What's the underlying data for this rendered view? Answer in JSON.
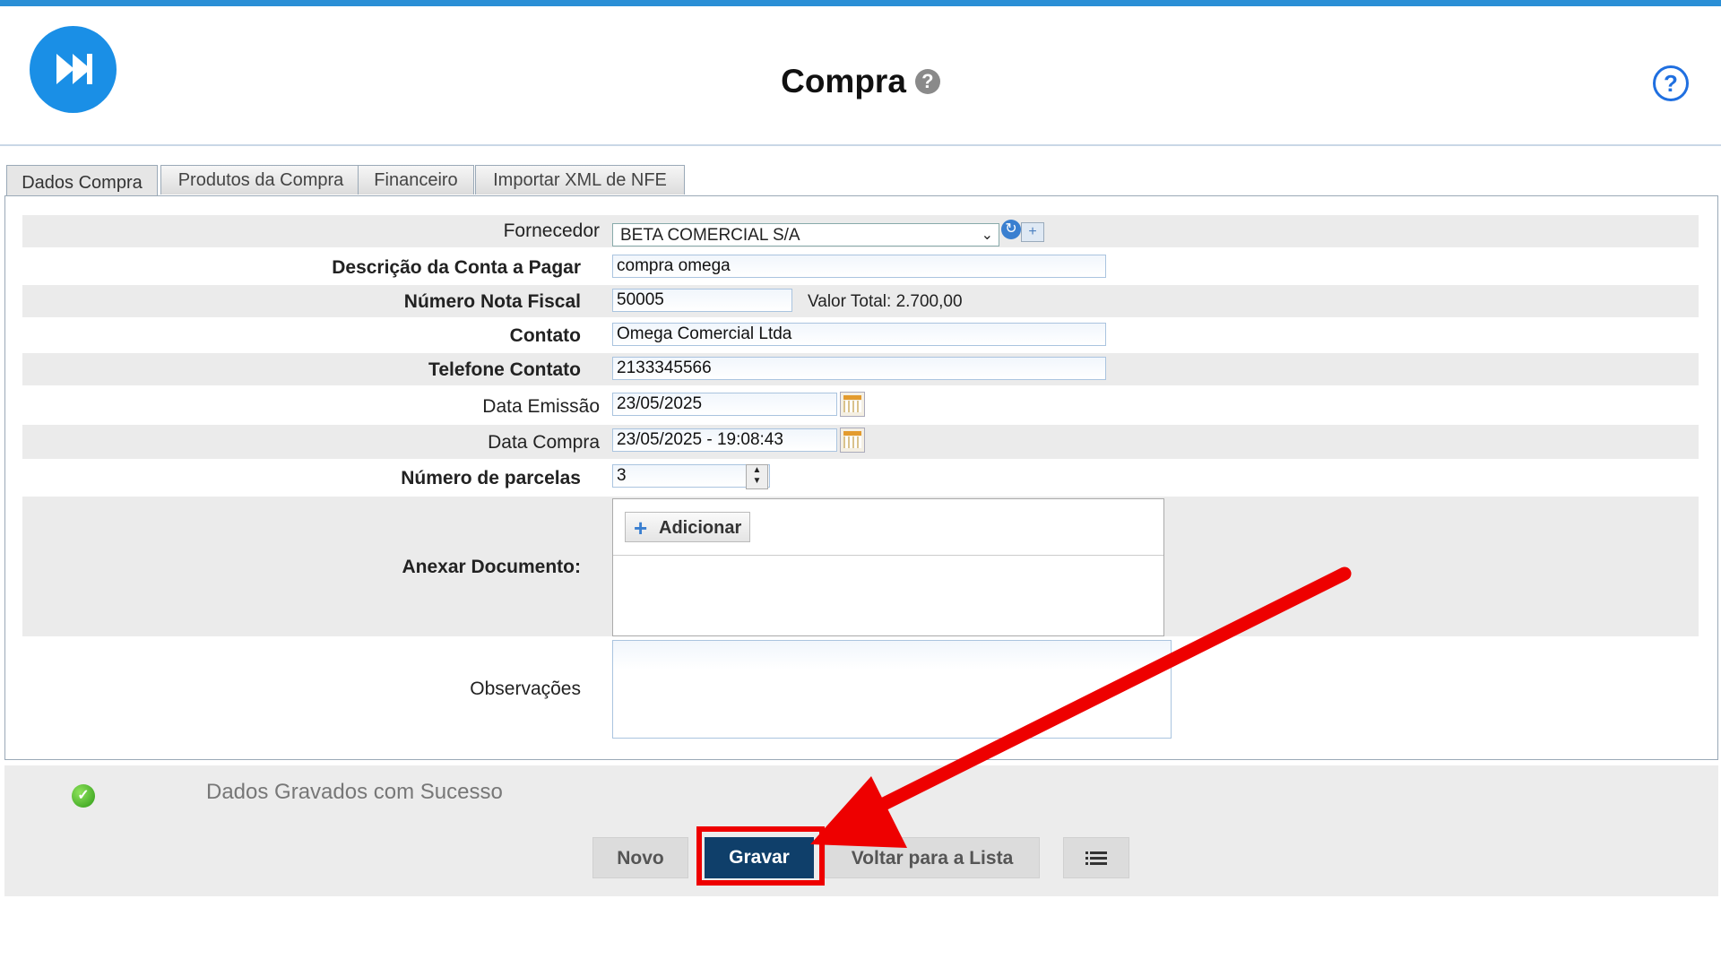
{
  "header": {
    "title": "Compra",
    "title_help_icon": "?",
    "help_icon": "?",
    "logo_icon": "fast-forward-icon"
  },
  "tabs": [
    {
      "label": "Dados Compra",
      "active": true
    },
    {
      "label": "Produtos da Compra",
      "active": false
    },
    {
      "label": "Financeiro",
      "active": false
    },
    {
      "label": "Importar XML de NFE",
      "active": false
    }
  ],
  "form": {
    "fornecedor": {
      "label": "Fornecedor",
      "value": "BETA COMERCIAL S/A"
    },
    "descricao": {
      "label": "Descrição da Conta a Pagar",
      "value": "compra omega"
    },
    "nota_fiscal": {
      "label": "Número Nota Fiscal",
      "value": "50005"
    },
    "valor_total": "Valor Total: 2.700,00",
    "contato": {
      "label": "Contato",
      "value": "Omega Comercial Ltda"
    },
    "telefone": {
      "label": "Telefone Contato",
      "value": "2133345566"
    },
    "data_emissao": {
      "label": "Data Emissão",
      "value": "23/05/2025"
    },
    "data_compra": {
      "label": "Data Compra",
      "value": "23/05/2025 - 19:08:43"
    },
    "parcelas": {
      "label": "Número de parcelas",
      "value": "3"
    },
    "anexar": {
      "label": "Anexar Documento:",
      "button": "Adicionar"
    },
    "observacoes": {
      "label": "Observações",
      "value": ""
    }
  },
  "footer": {
    "message": "Dados Gravados com Sucesso",
    "buttons": {
      "novo": "Novo",
      "gravar": "Gravar",
      "voltar": "Voltar para a Lista",
      "list_icon": "list-icon"
    }
  },
  "colors": {
    "accent": "#1a8fe6",
    "primary_button": "#0f3f6a",
    "annotation": "#ee0000"
  }
}
